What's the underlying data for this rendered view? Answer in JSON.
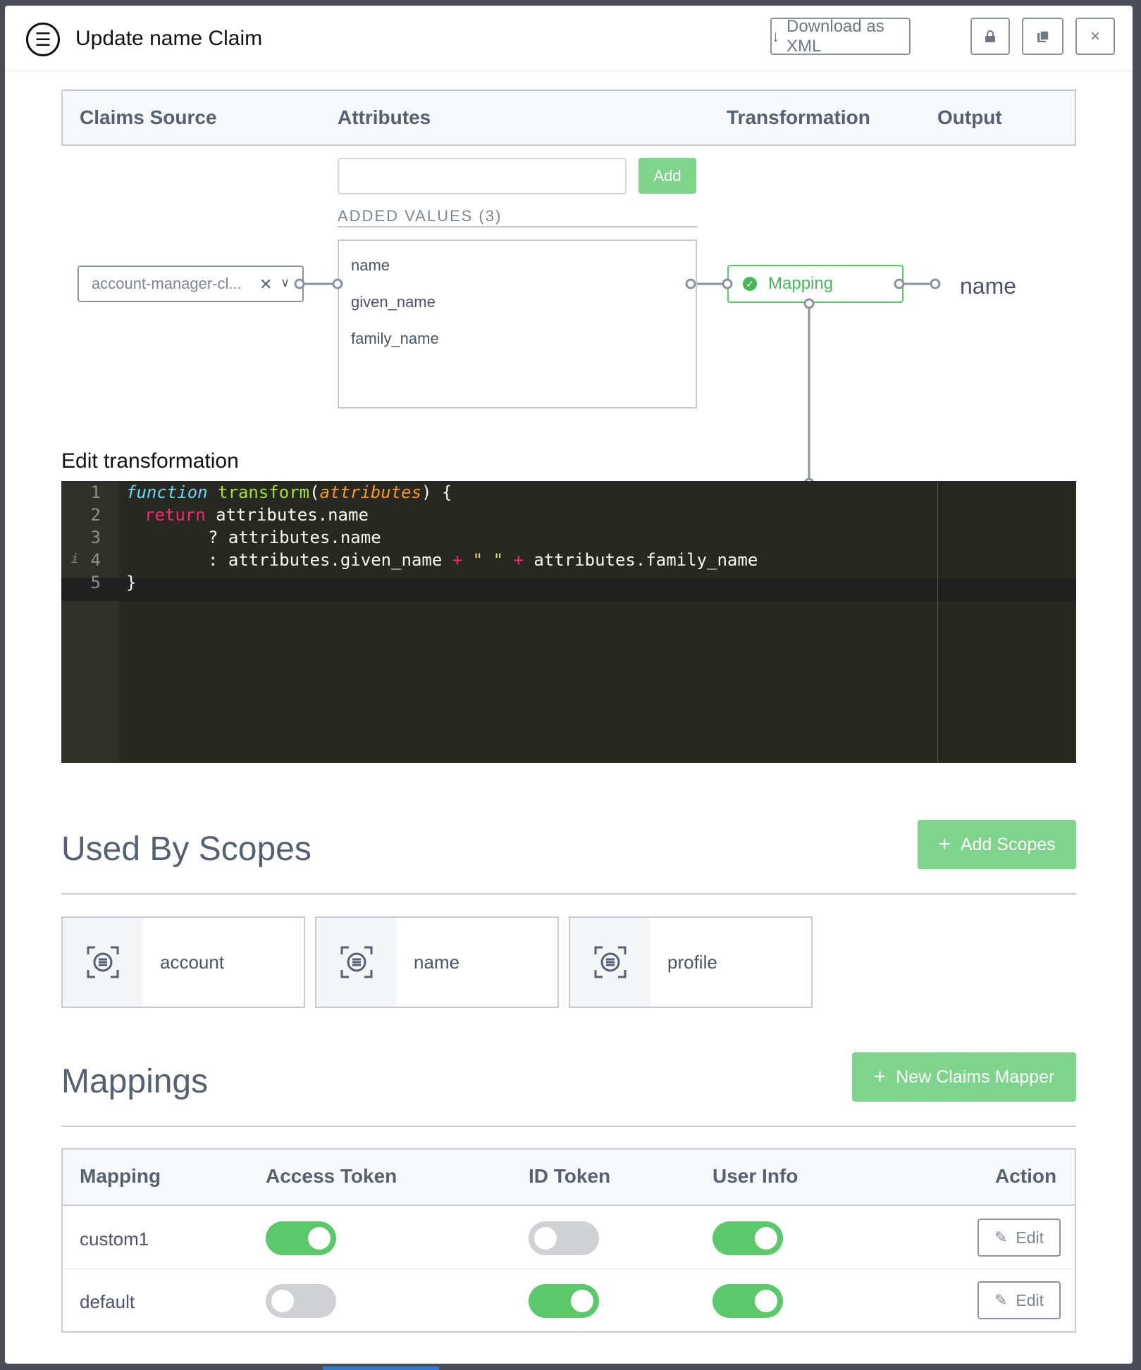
{
  "header": {
    "title": "Update name Claim",
    "download_label": "Download as XML",
    "lock_icon": "lock-icon",
    "copy_icon": "copy-icon",
    "close_label": "×"
  },
  "pipeline": {
    "columns": [
      "Claims Source",
      "Attributes",
      "Transformation",
      "Output"
    ],
    "attribute_input_value": "",
    "add_label": "Add",
    "added_values_label": "ADDED VALUES (3)",
    "values": [
      "name",
      "given_name",
      "family_name"
    ],
    "source_value": "account-manager-cl...",
    "transformation_label": "Mapping",
    "output_name": "name"
  },
  "editor": {
    "title": "Edit transformation",
    "line_numbers": [
      "1",
      "2",
      "3",
      "4",
      "5"
    ],
    "line1": {
      "kw": "function",
      "fn": "transform",
      "open": "(",
      "param": "attributes",
      "close": ") {"
    },
    "line2": {
      "kw": "return",
      "rest": " attributes.name"
    },
    "line3": "? attributes.name",
    "line4": {
      "a": ": attributes.given_name ",
      "plus1": "+",
      "s": " \" \" ",
      "plus2": "+",
      "b": " attributes.family_name"
    },
    "line5": "}"
  },
  "scopes": {
    "title": "Used By Scopes",
    "add_label": "Add Scopes",
    "items": [
      "account",
      "name",
      "profile"
    ]
  },
  "mappings": {
    "title": "Mappings",
    "new_label": "New Claims Mapper",
    "columns": [
      "Mapping",
      "Access Token",
      "ID Token",
      "User Info",
      "Action"
    ],
    "rows": [
      {
        "name": "custom1",
        "access_token": true,
        "id_token": false,
        "user_info": true,
        "action": "Edit"
      },
      {
        "name": "default",
        "access_token": false,
        "id_token": true,
        "user_info": true,
        "action": "Edit"
      }
    ]
  },
  "colors": {
    "accent_green": "#5bc86a",
    "button_green": "#7dd48a",
    "editor_bg": "#272822"
  }
}
